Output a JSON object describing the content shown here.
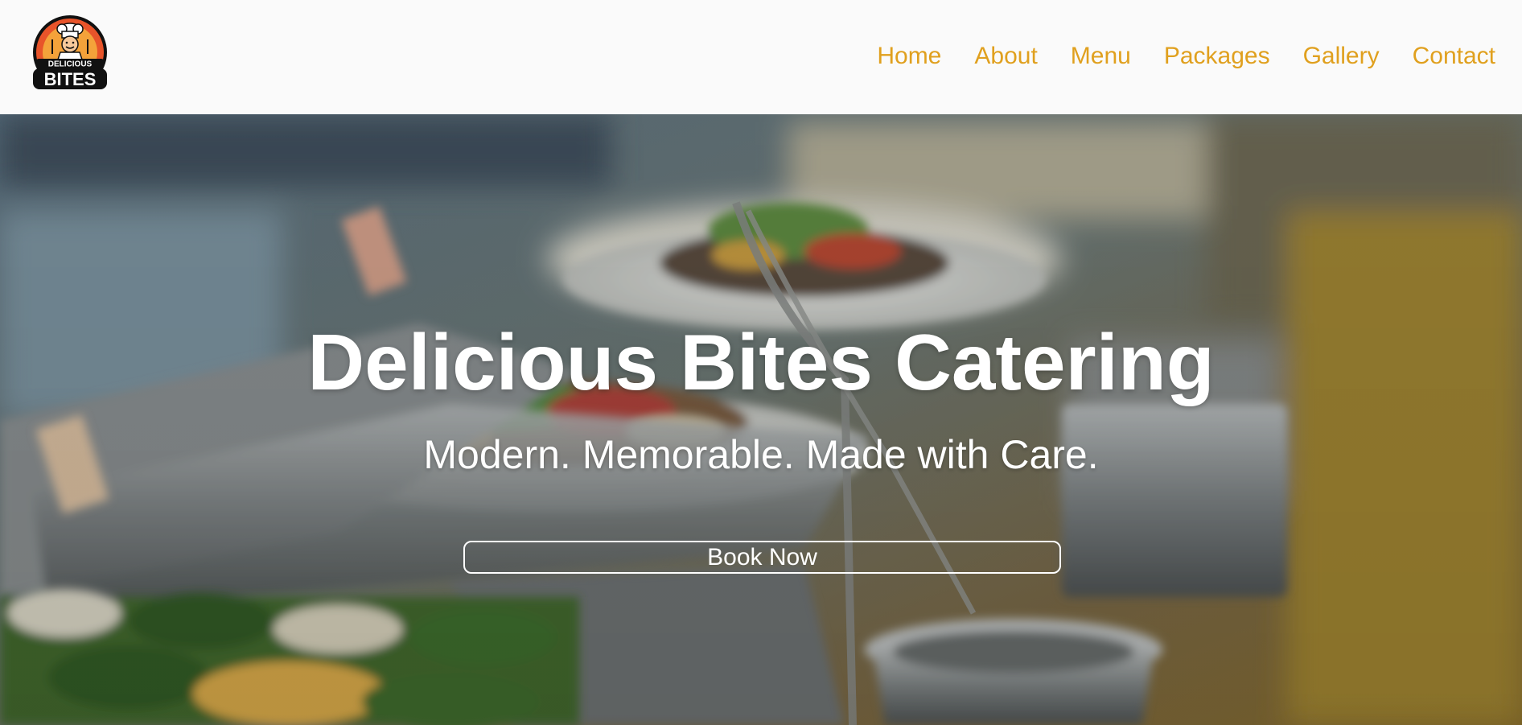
{
  "brand": {
    "logo_text_top": "DELICIOUS",
    "logo_text_bottom": "BITES",
    "logo_icon": "chef-mascot-icon"
  },
  "nav": {
    "items": [
      {
        "label": "Home"
      },
      {
        "label": "About"
      },
      {
        "label": "Menu"
      },
      {
        "label": "Packages"
      },
      {
        "label": "Gallery"
      },
      {
        "label": "Contact"
      }
    ]
  },
  "hero": {
    "title": "Delicious Bites Catering",
    "subtitle": "Modern. Memorable. Made with Care.",
    "cta_label": "Book Now"
  },
  "colors": {
    "nav_text": "#e0a01e",
    "header_bg": "#fafafa",
    "hero_text": "#ffffff"
  }
}
